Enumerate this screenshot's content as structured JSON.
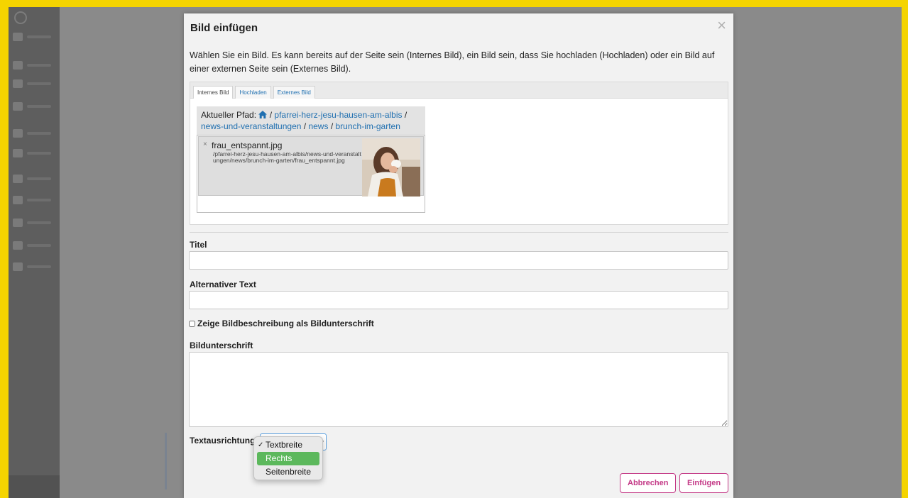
{
  "dialog": {
    "title": "Bild einfügen",
    "close_label": "×",
    "intro": "Wählen Sie ein Bild. Es kann bereits auf der Seite sein (Internes Bild), ein Bild sein, dass Sie hochladen (Hochladen) oder ein Bild auf einer externen Seite sein (Externes Bild)."
  },
  "tabs": [
    {
      "label": "Internes Bild",
      "active": true
    },
    {
      "label": "Hochladen",
      "active": false
    },
    {
      "label": "Externes Bild",
      "active": false
    }
  ],
  "path": {
    "prefix": "Aktueller Pfad:",
    "separator": "/",
    "segments": [
      "pfarrei-herz-jesu-hausen-am-albis",
      "news-und-veranstaltungen",
      "news",
      "brunch-im-garten"
    ]
  },
  "file": {
    "remove_label": "×",
    "name": "frau_entspannt.jpg",
    "path": "/pfarrei-herz-jesu-hausen-am-albis/news-und-veranstaltungen/news/brunch-im-garten/frau_entspannt.jpg"
  },
  "form": {
    "title_label": "Titel",
    "title_value": "",
    "alt_label": "Alternativer Text",
    "alt_value": "",
    "checkbox_label": "Zeige Bildbeschreibung als Bildunterschrift",
    "caption_label": "Bildunterschrift",
    "caption_value": "",
    "align_label": "Textausrichtung"
  },
  "dropdown": {
    "options": [
      {
        "label": "Textbreite",
        "checked": true,
        "highlighted": false
      },
      {
        "label": "Rechts",
        "checked": false,
        "highlighted": true
      },
      {
        "label": "Seitenbreite",
        "checked": false,
        "highlighted": false
      }
    ]
  },
  "buttons": {
    "cancel": "Abbrechen",
    "insert": "Einfügen"
  },
  "colors": {
    "accent": "#c43a87",
    "link": "#1f6fb0",
    "highlight": "#5cb85c",
    "frame": "#f5d400"
  }
}
